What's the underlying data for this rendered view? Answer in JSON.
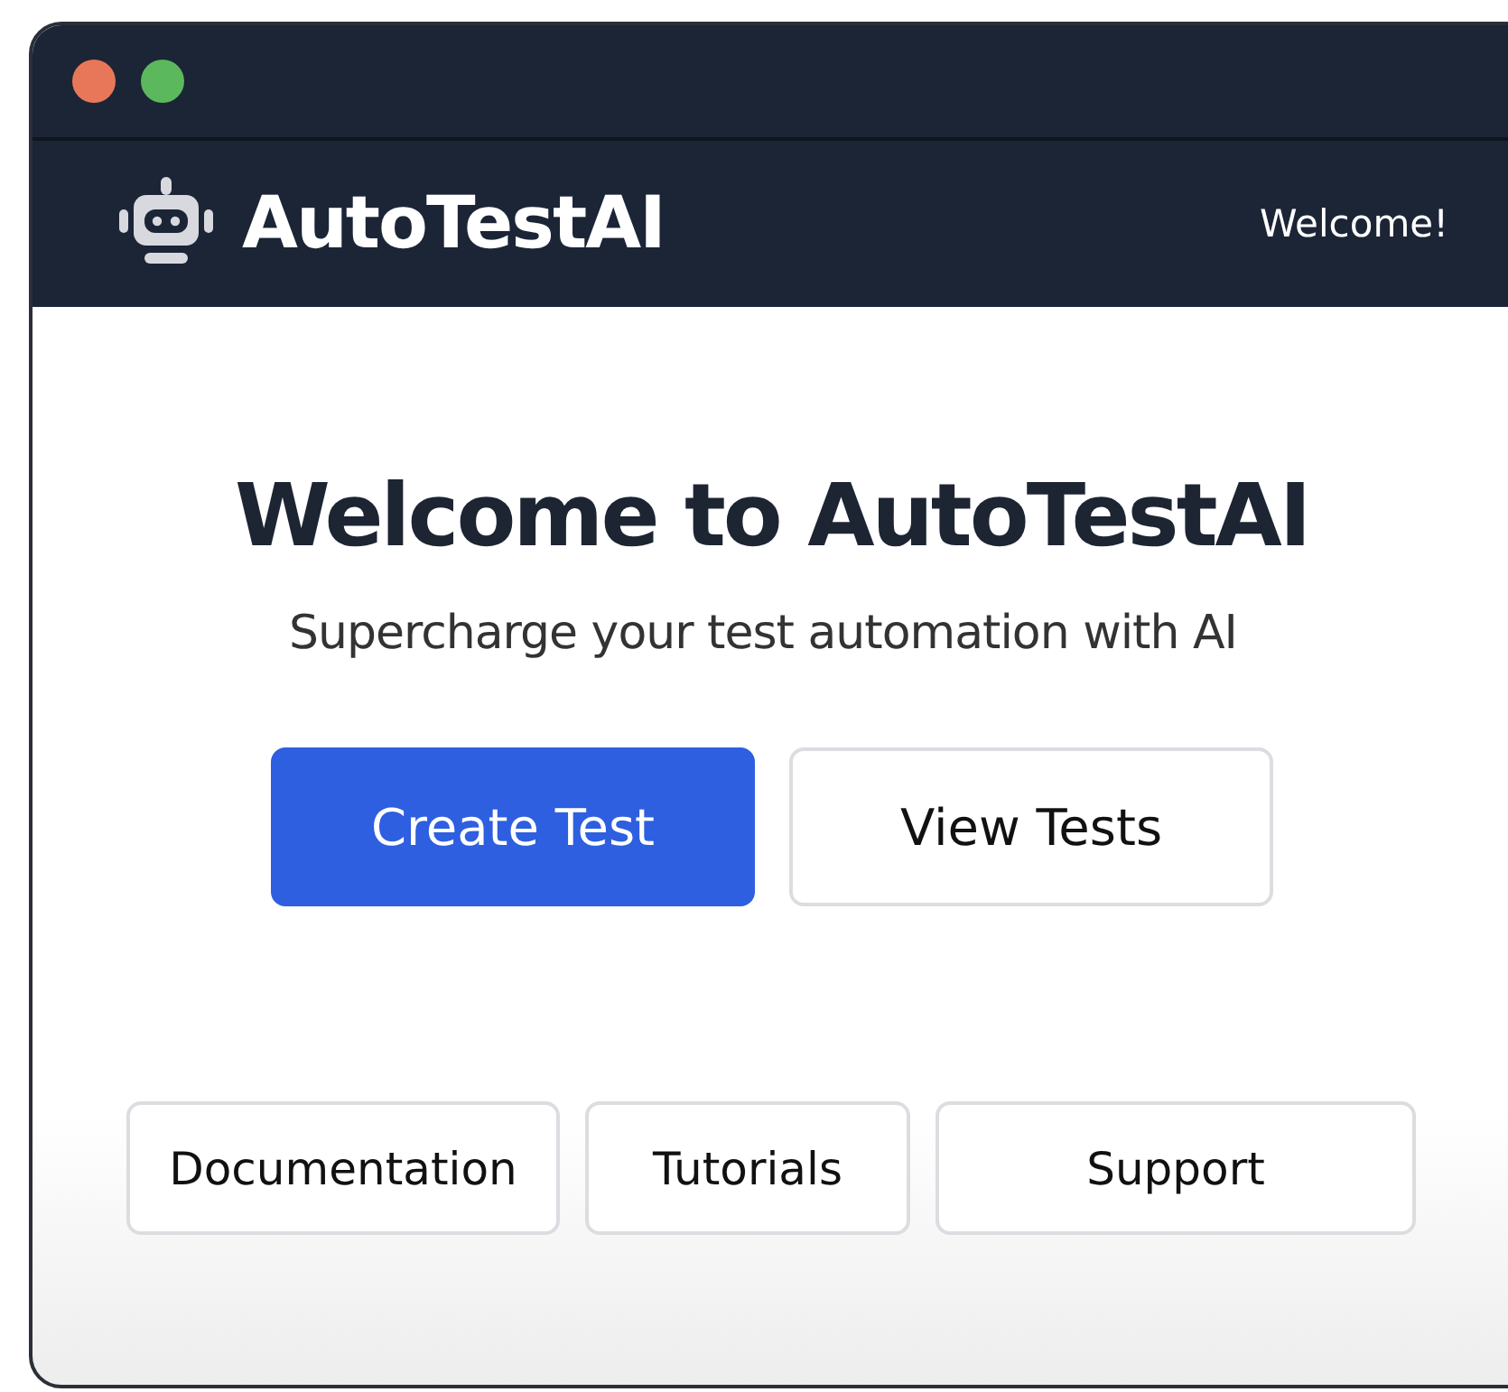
{
  "window": {
    "controls": [
      {
        "color": "#e8775a"
      },
      {
        "color": "#5cb85c"
      }
    ]
  },
  "header": {
    "app_name": "AutoTestAI",
    "greeting": "Welcome!"
  },
  "hero": {
    "title": "Welcome to AutoTestAI",
    "subtitle": "Supercharge your test automation with AI"
  },
  "actions": [
    {
      "label": "Create Test",
      "kind": "primary"
    },
    {
      "label": "View Tests",
      "kind": "secondary"
    }
  ],
  "links": [
    {
      "label": "Documentation"
    },
    {
      "label": "Tutorials"
    },
    {
      "label": "Support"
    }
  ]
}
